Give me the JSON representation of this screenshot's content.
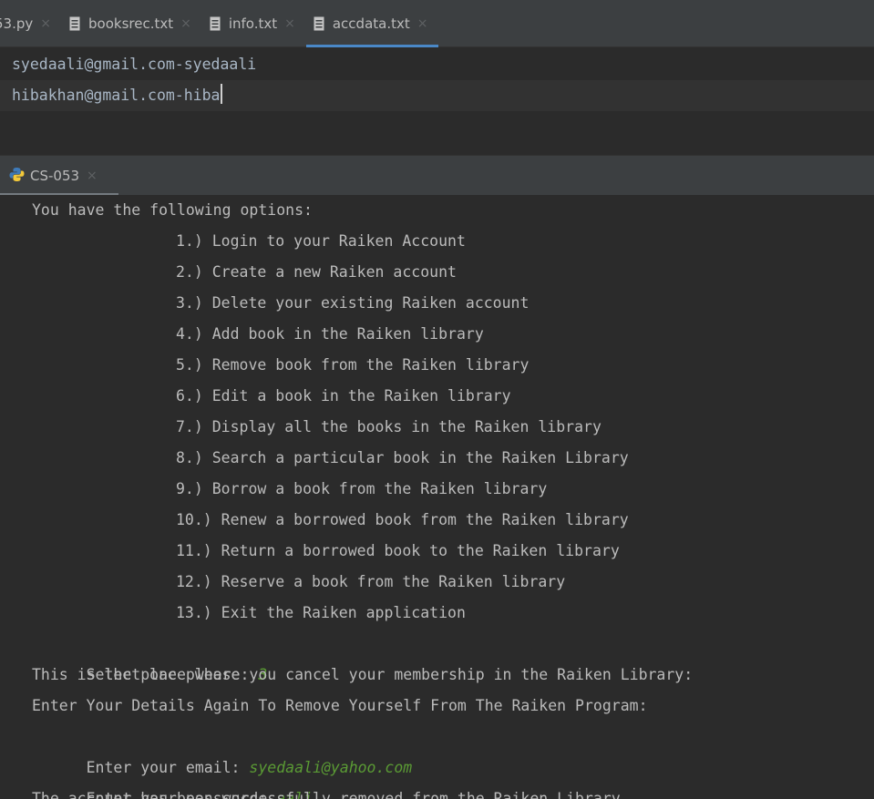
{
  "editor_tabs": [
    {
      "label": "53.py",
      "icon": "python-file-icon",
      "active": false
    },
    {
      "label": "booksrec.txt",
      "icon": "text-file-icon",
      "active": false
    },
    {
      "label": "info.txt",
      "icon": "text-file-icon",
      "active": false
    },
    {
      "label": "accdata.txt",
      "icon": "text-file-icon",
      "active": true
    }
  ],
  "tab_close_glyph": "×",
  "editor_lines": [
    "syedaali@gmail.com-syedaali",
    "hibakhan@gmail.com-hiba"
  ],
  "run_tab": {
    "label": "CS-053",
    "icon": "python-run-icon"
  },
  "console": {
    "header": "You have the following options:",
    "options": [
      "1.) Login to your Raiken Account",
      "2.) Create a new Raiken account",
      "3.) Delete your existing Raiken account",
      "4.) Add book in the Raiken library",
      "5.) Remove book from the Raiken library",
      "6.) Edit a book in the Raiken library",
      "7.) Display all the books in the Raiken library",
      "8.) Search a particular book in the Raiken Library",
      "9.) Borrow a book from the Raiken library",
      "10.) Renew a borrowed book from the Raiken library",
      "11.) Return a borrowed book to the Raiken library",
      "12.) Reserve a book from the Raiken library",
      "13.) Exit the Raiken application"
    ],
    "select_prompt": "Select one please: ",
    "select_value": "3",
    "cancel_msg": "This is the place where you cancel your membership in the Raiken Library:",
    "details_msg": "Enter Your Details Again To Remove Yourself From The Raiken Program:",
    "email_prompt": "Enter your email: ",
    "email_value": "syedaali@yahoo.com",
    "password_prompt": "Enter your password: ",
    "password_value": "aali",
    "result_msg": "The account has been successfully removed from the Raiken Library."
  },
  "colors": {
    "background": "#2b2b2b",
    "toolbar": "#3c3f41",
    "text": "#bbbbbb",
    "user_input": "#5a9a34",
    "active_tab_underline": "#4a88c7"
  }
}
